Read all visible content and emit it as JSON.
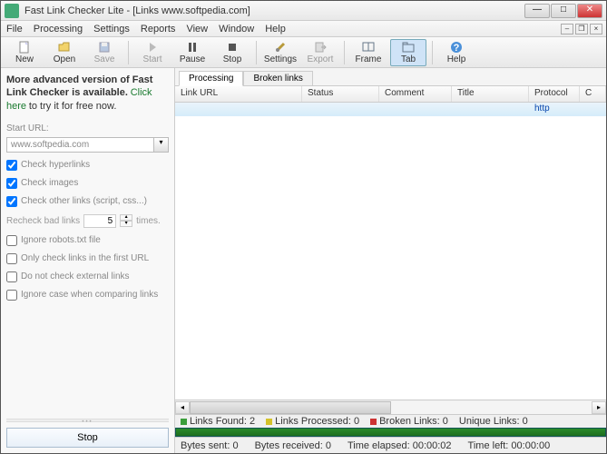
{
  "window": {
    "title": "Fast Link Checker Lite - [Links www.softpedia.com]"
  },
  "menu": {
    "items": [
      "File",
      "Processing",
      "Settings",
      "Reports",
      "View",
      "Window",
      "Help"
    ]
  },
  "toolbar": {
    "new": "New",
    "open": "Open",
    "save": "Save",
    "start": "Start",
    "pause": "Pause",
    "stop": "Stop",
    "settings": "Settings",
    "export": "Export",
    "frame": "Frame",
    "tab": "Tab",
    "help": "Help"
  },
  "promo": {
    "line1": "More advanced version of Fast Link Checker is available.",
    "link": "Click here",
    "line2": "to try it for free now."
  },
  "sidebar": {
    "start_url_label": "Start URL:",
    "start_url_value": "www.softpedia.com",
    "chk_hyperlinks": "Check hyperlinks",
    "chk_images": "Check images",
    "chk_other": "Check other links (script, css...)",
    "recheck_label": "Recheck bad links",
    "recheck_value": "5",
    "recheck_times": "times.",
    "chk_robots": "Ignore robots.txt file",
    "chk_first_url": "Only check links in the first URL",
    "chk_external": "Do not check external links",
    "chk_case": "Ignore case when comparing links",
    "stop": "Stop"
  },
  "tabs": {
    "processing": "Processing",
    "broken": "Broken links"
  },
  "columns": {
    "url": "Link URL",
    "status": "Status",
    "comment": "Comment",
    "title": "Title",
    "protocol": "Protocol",
    "last": "C"
  },
  "rows": [
    {
      "protocol": "http"
    }
  ],
  "status1": {
    "found": "Links Found: 2",
    "processed": "Links Processed: 0",
    "broken": "Broken Links: 0",
    "unique": "Unique Links: 0"
  },
  "status2": {
    "sent": "Bytes sent: 0",
    "received": "Bytes received: 0",
    "elapsed": "Time elapsed: 00:00:02",
    "left": "Time left: 00:00:00"
  }
}
